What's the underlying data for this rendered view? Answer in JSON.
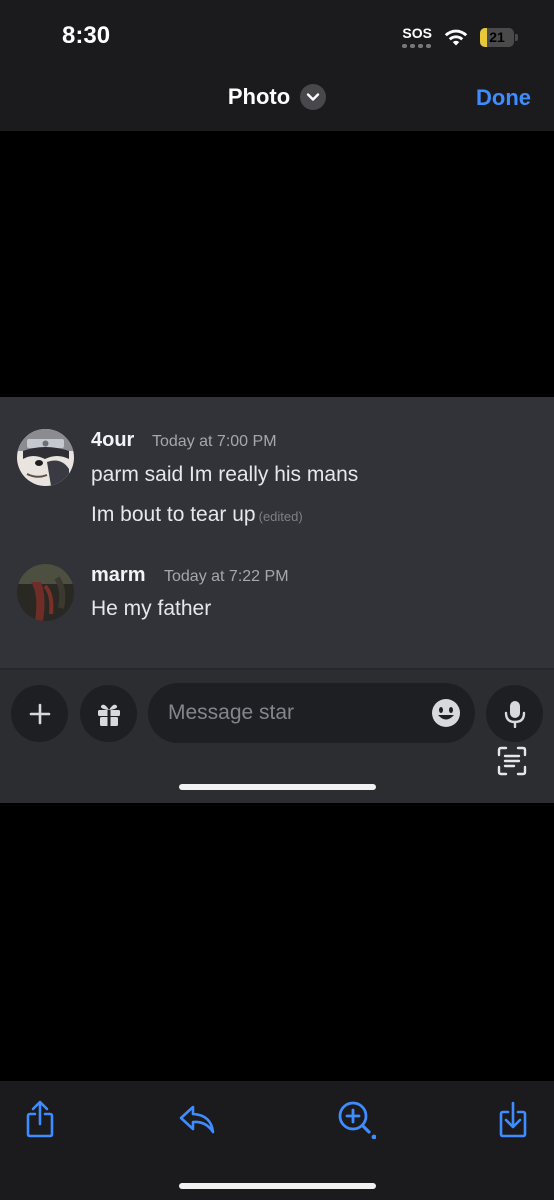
{
  "status_bar": {
    "time": "8:30",
    "sos": "SOS",
    "battery_level": "21",
    "battery_fraction": 0.21
  },
  "nav": {
    "title": "Photo",
    "done_label": "Done"
  },
  "chat": {
    "messages": [
      {
        "author": "4our",
        "timestamp": "Today at 7:00 PM",
        "lines": [
          "parm said Im really his mans",
          "Im bout to tear up"
        ],
        "edited_label": "(edited)"
      },
      {
        "author": "marm",
        "timestamp": "Today at 7:22 PM",
        "lines": [
          "He my father"
        ]
      }
    ],
    "composer": {
      "placeholder": "Message star"
    }
  },
  "toolbar": {
    "items": [
      "share-icon",
      "reply-icon",
      "zoom-in-icon",
      "save-download-icon"
    ]
  },
  "colors": {
    "accent": "#3f8cff",
    "chat_bg": "#313338",
    "composer_bg": "#2b2d31"
  }
}
